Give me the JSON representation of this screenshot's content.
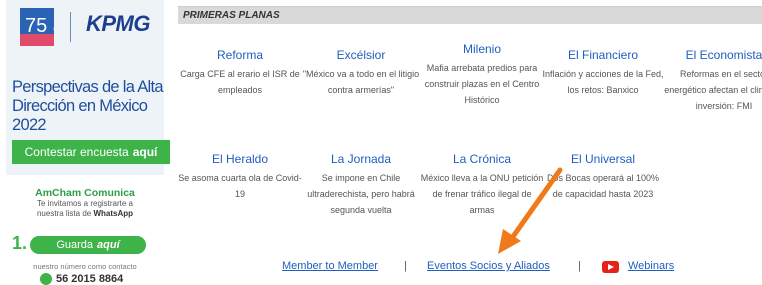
{
  "sidebar": {
    "anniversary_logo": "75 años",
    "brand_logo": "KPMG",
    "perspectivas_title": "Perspectivas de la Alta Dirección en México 2022",
    "encuesta_button": {
      "label": "Contestar encuesta",
      "emphasis": "aquí"
    },
    "amcham": {
      "title": "AmCham Comunica",
      "line1": "Te invitamos a registrarte a",
      "line2_prefix": "nuestra lista de",
      "line2_bold": "WhatsApp"
    },
    "step_number": "1.",
    "guarda_button": {
      "label": "Guarda",
      "emphasis": "aquí"
    },
    "contact_note": "nuestro número como contacto",
    "phone": "56 2015 8864"
  },
  "primeras_planas": {
    "section_title": "PRIMERAS PLANAS",
    "papers": [
      {
        "name": "Reforma",
        "headline": "Carga CFE al erario el ISR de empleados"
      },
      {
        "name": "Excélsior",
        "headline": "\"México va a todo en el litigio contra armerías\""
      },
      {
        "name": "Milenio",
        "headline": "Mafia arrebata predios para construir plazas en el Centro Histórico"
      },
      {
        "name": "El Financiero",
        "headline": "Inflación y acciones de la Fed, los retos: Banxico"
      },
      {
        "name": "El Economista",
        "headline": "Reformas en el sector energético afectan el clima de inversión: FMI"
      },
      {
        "name": "El Heraldo",
        "headline": "Se asoma cuarta ola de Covid-19"
      },
      {
        "name": "La Jornada",
        "headline": "Se impone en Chile ultraderechista, pero habrá segunda vuelta"
      },
      {
        "name": "La Crónica",
        "headline": "México lleva a la ONU petición de frenar tráfico ilegal de armas"
      },
      {
        "name": "El Universal",
        "headline": "Dos Bocas operará al 100% de capacidad hasta 2023"
      }
    ]
  },
  "footer": {
    "member_link": "Member to Member",
    "separator": "|",
    "eventos_link": "Eventos Socios y Aliados",
    "webinars_link": "Webinars"
  },
  "colors": {
    "link_blue": "#1f5fbf",
    "green": "#3db34a",
    "kpmg_blue": "#1e3f8f",
    "arrow_orange": "#f07a1a"
  }
}
